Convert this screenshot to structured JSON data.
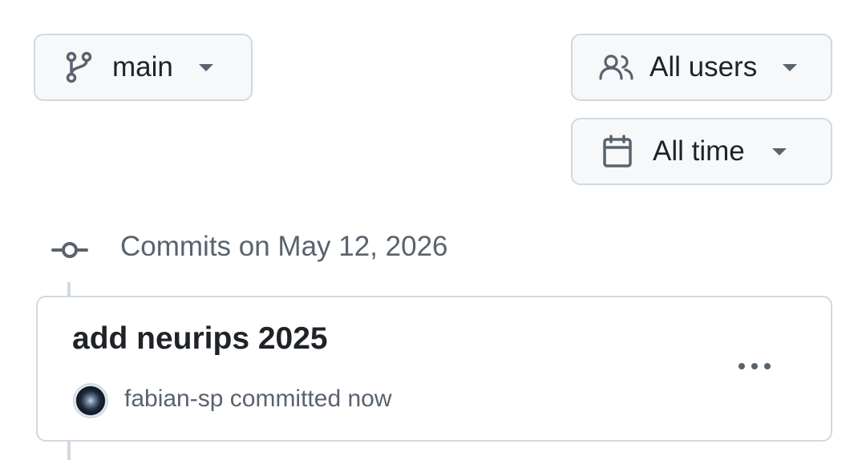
{
  "filters": {
    "branch": {
      "label": "main",
      "icon": "git-branch-icon"
    },
    "users": {
      "label": "All users",
      "icon": "people-icon"
    },
    "time": {
      "label": "All time",
      "icon": "calendar-icon"
    }
  },
  "commit_group": {
    "heading": "Commits on May 12, 2026",
    "icon": "git-commit-icon",
    "commits": [
      {
        "title": "add neurips 2025",
        "author": "fabian-sp",
        "action": "committed",
        "time": "now",
        "more_icon": "kebab-horizontal-icon"
      }
    ]
  },
  "colors": {
    "text_primary": "#1f2328",
    "text_muted": "#59636e",
    "border": "#d1d9e0",
    "button_bg": "#f6f8fa"
  }
}
